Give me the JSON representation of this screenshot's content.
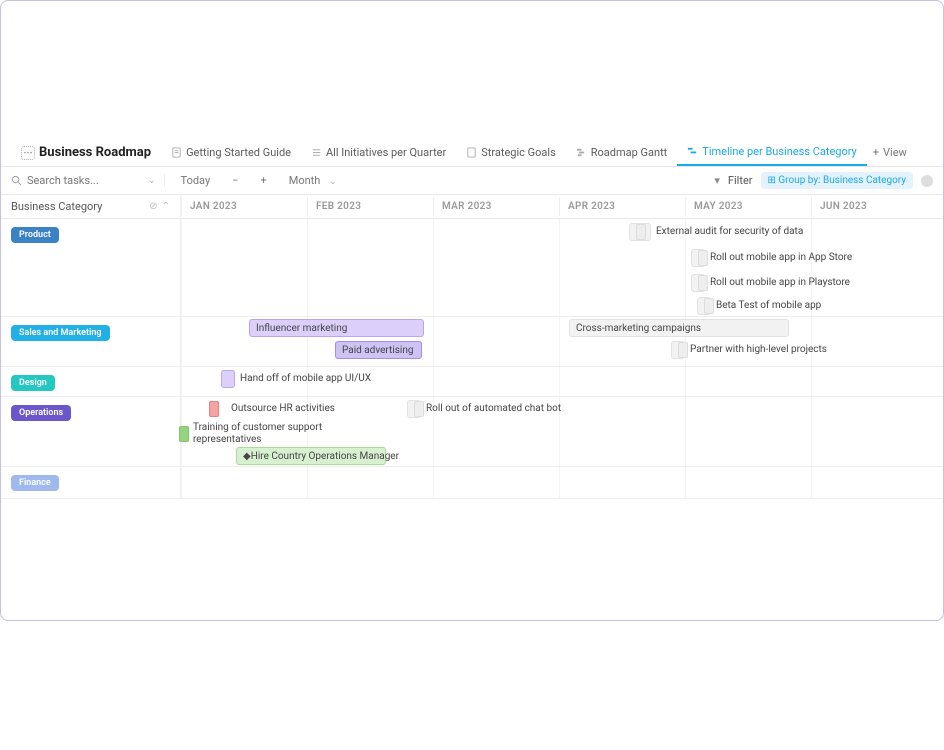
{
  "title": "Business Roadmap",
  "tabs": [
    {
      "label": "Getting Started Guide"
    },
    {
      "label": "All Initiatives per Quarter"
    },
    {
      "label": "Strategic Goals"
    },
    {
      "label": "Roadmap Gantt"
    },
    {
      "label": "Timeline per Business Category",
      "active": true
    }
  ],
  "addView": "View",
  "search": {
    "placeholder": "Search tasks..."
  },
  "toolbar": {
    "today": "Today",
    "timescale": "Month",
    "filter": "Filter",
    "groupby": "Group by: Business Category"
  },
  "sidebarHeader": "Business Category",
  "months": [
    "JAN 2023",
    "FEB 2023",
    "MAR 2023",
    "APR 2023",
    "MAY 2023",
    "JUN 2023"
  ],
  "categories": {
    "product": {
      "label": "Product",
      "color": "#3b82c4"
    },
    "sales": {
      "label": "Sales and Marketing",
      "color": "#22b0e6"
    },
    "design": {
      "label": "Design",
      "color": "#25c7c2"
    },
    "ops": {
      "label": "Operations",
      "color": "#6b57c9"
    },
    "finance": {
      "label": "Finance",
      "color": "#9fb8ee"
    }
  },
  "tasks": {
    "t1": "External audit for security of data",
    "t2": "Roll out mobile app in App Store",
    "t3": "Roll out mobile app in Playstore",
    "t4": "Beta Test of mobile app",
    "t5": "Influencer marketing",
    "t6": "Paid advertising",
    "t7": "Cross-marketing campaigns",
    "t8": "Partner with high-level projects",
    "t9": "Hand off of mobile app UI/UX",
    "t10": "Outsource HR activities",
    "t11": "Training of customer support representatives",
    "t12": "Hire Country Operations Manager",
    "t13": "Roll out of automated chat bot"
  }
}
